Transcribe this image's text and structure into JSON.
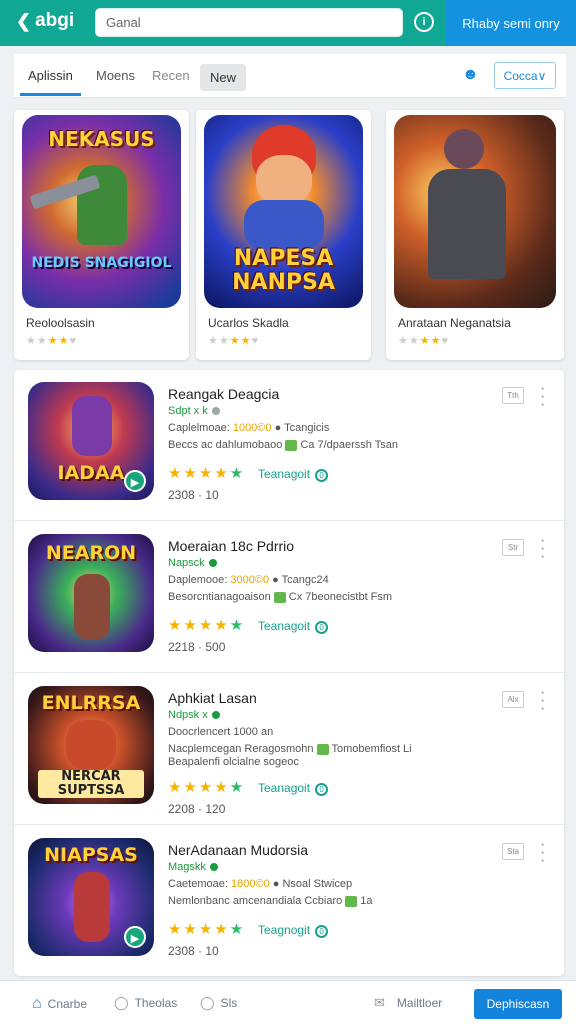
{
  "header": {
    "logo_text": "abgi",
    "search_value": "Ganal",
    "info_icon": "i",
    "right_label": "Rhaby semi onry",
    "colors": {
      "teal": "#10a894",
      "blue": "#1492e0"
    }
  },
  "tabs": {
    "items": [
      "Aplissin",
      "Moens",
      "Recen",
      "New"
    ],
    "dropdown_label": "Cocca∨"
  },
  "featured": [
    {
      "name": "Reoloolsasin",
      "art_title": "NEKASUS",
      "art_sub": "NEDIS SNAGIGIOL",
      "stars": 3
    },
    {
      "name": "Ucarlos Skadla",
      "art_title": "NAPESA NANPSA",
      "art_sub": "",
      "stars": 3
    },
    {
      "name": "Anrataan Neganatsia",
      "art_title": "",
      "art_sub": "",
      "stars": 3
    }
  ],
  "list": [
    {
      "title": "Reangak Deagcia",
      "developer": "Sdpt x k",
      "line1_a": "Caplelmoae:",
      "line1_hl": "1000©0",
      "line1_b": "Tcangicis",
      "line2_a": "Beccs ac dahlumobaoo",
      "line2_b": "Ca 7/dpaerssh Tsan",
      "rating_label": "Teanagoit",
      "date": "2308 · 10",
      "chip": "Tth",
      "thumb_title": "IADAA"
    },
    {
      "title": "Moeraian 18c Pdrrio",
      "developer": "Napsck",
      "line1_a": "Daplemooe:",
      "line1_hl": "3000©0",
      "line1_b": "Tcangc24",
      "line2_a": "Besorcntianagoaison",
      "line2_b": "Cx 7beonecistbt Fsm",
      "rating_label": "Teanagoit",
      "date": "2218 · 500",
      "chip": "Str",
      "thumb_title": "NEARON"
    },
    {
      "title": "Aphkiat Lasan",
      "developer": "Ndpsk x",
      "line1_a": "Doocrlencert",
      "line1_hl": "1000 an",
      "line1_b": "",
      "line2_a": "Nacplemcegan Reragosmohn",
      "line2_b": "Tomobemfiost Li",
      "line3": "Beapalenfi olcialne sogeoc",
      "rating_label": "Teanagoit",
      "date": "2208 · 120",
      "chip": "Alx",
      "thumb_title": "ENLRRSA"
    },
    {
      "title": "NerAdanaan Mudorsia",
      "developer": "Magskk",
      "line1_a": "Caetemoae:",
      "line1_hl": "1800©0",
      "line1_b": "Nsoal Stwicep",
      "line2_a": "Nemlonbanc amcenandiala Ccbiaro",
      "line2_b": "1a",
      "rating_label": "Teagnogit",
      "date": "2308 · 10",
      "chip": "Sta",
      "thumb_title": "NIAPSAS"
    }
  ],
  "bottom_nav": {
    "items": [
      "Cnarbe",
      "Theolas",
      "Sls",
      "Mailtloer"
    ],
    "cta": "Dephiscasn"
  }
}
